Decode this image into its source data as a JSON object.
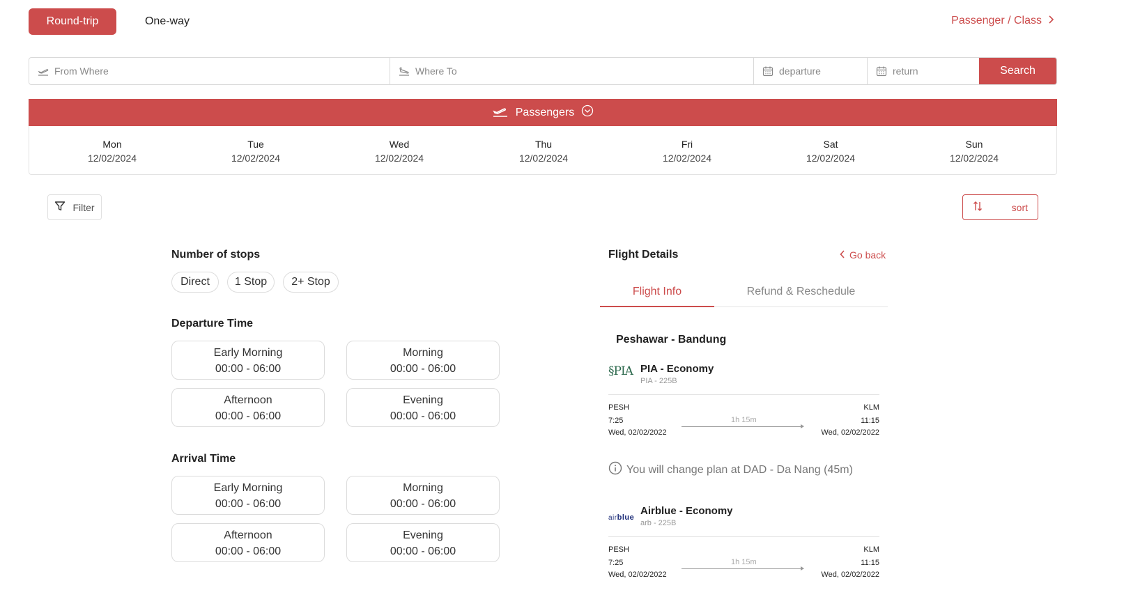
{
  "trip": {
    "round_trip": "Round-trip",
    "one_way": "One-way",
    "passenger_class": "Passenger / Class"
  },
  "search": {
    "from_placeholder": "From Where",
    "to_placeholder": "Where To",
    "departure_placeholder": "departure",
    "return_placeholder": "return",
    "button": "Search"
  },
  "passengers_bar": {
    "label": "Passengers"
  },
  "days": [
    {
      "name": "Mon",
      "date": "12/02/2024"
    },
    {
      "name": "Tue",
      "date": "12/02/2024"
    },
    {
      "name": "Wed",
      "date": "12/02/2024"
    },
    {
      "name": "Thu",
      "date": "12/02/2024"
    },
    {
      "name": "Fri",
      "date": "12/02/2024"
    },
    {
      "name": "Sat",
      "date": "12/02/2024"
    },
    {
      "name": "Sun",
      "date": "12/02/2024"
    }
  ],
  "toolbar": {
    "filter": "Filter",
    "sort": "sort"
  },
  "filters": {
    "stops_title": "Number of stops",
    "stops": [
      "Direct",
      "1 Stop",
      "2+ Stop"
    ],
    "departure_title": "Departure Time",
    "departure_slots": [
      {
        "label": "Early Morning",
        "range": "00:00 - 06:00"
      },
      {
        "label": "Morning",
        "range": "00:00 - 06:00"
      },
      {
        "label": "Afternoon",
        "range": "00:00 - 06:00"
      },
      {
        "label": "Evening",
        "range": "00:00 - 06:00"
      }
    ],
    "arrival_title": "Arrival Time",
    "arrival_slots": [
      {
        "label": "Early Morning",
        "range": "00:00 - 06:00"
      },
      {
        "label": "Morning",
        "range": "00:00 - 06:00"
      },
      {
        "label": "Afternoon",
        "range": "00:00 - 06:00"
      },
      {
        "label": "Evening",
        "range": "00:00 - 06:00"
      }
    ]
  },
  "details": {
    "title": "Flight Details",
    "go_back": "Go back",
    "tabs": [
      "Flight Info",
      "Refund & Reschedule"
    ],
    "route": "Peshawar - Bandung",
    "change_note": "You will change plan at DAD - Da Nang (45m)",
    "segments": [
      {
        "logo_text": "PIA",
        "airline": "PIA - Economy",
        "code": "PIA - 225B",
        "from_code": "PESH",
        "dep_time": "7:25",
        "dep_date": "Wed, 02/02/2022",
        "to_code": "KLM",
        "arr_time": "11:15",
        "arr_date": "Wed, 02/02/2022",
        "duration": "1h 15m"
      },
      {
        "logo_text_a": "air",
        "logo_text_b": "blue",
        "airline": "Airblue - Economy",
        "code": "arb - 225B",
        "from_code": "PESH",
        "dep_time": "7:25",
        "dep_date": "Wed, 02/02/2022",
        "to_code": "KLM",
        "arr_time": "11:15",
        "arr_date": "Wed, 02/02/2022",
        "duration": "1h 15m"
      }
    ]
  },
  "colors": {
    "accent": "#cc4c4c",
    "border": "#dcdcdc",
    "muted": "#888888"
  }
}
